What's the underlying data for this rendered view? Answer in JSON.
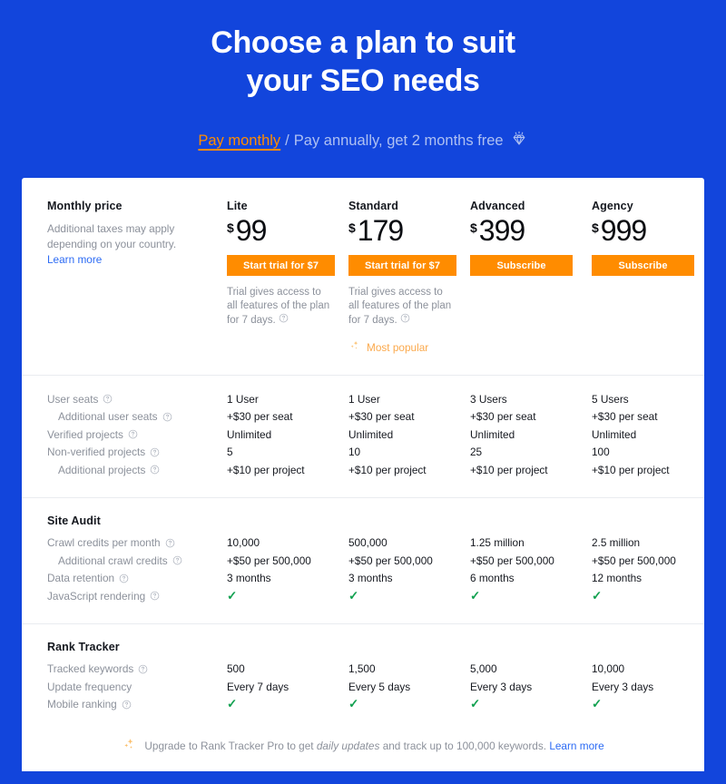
{
  "hero": {
    "title_line1": "Choose a plan to suit",
    "title_line2": "your SEO needs",
    "billing_active": "Pay monthly",
    "billing_separator": "/",
    "billing_alternative": "Pay annually, get 2 months free",
    "gem_icon": "gem-icon"
  },
  "colors": {
    "background_blue": "#1245DC",
    "accent_orange": "#FF8C00",
    "link_blue": "#2C6BF4",
    "check_green": "#12A150",
    "muted_text": "#8C919B"
  },
  "price_section": {
    "title": "Monthly price",
    "description": "Additional taxes may apply depending on your country.",
    "learn_more": "Learn more"
  },
  "plans": [
    {
      "name": "Lite",
      "currency": "$",
      "amount": "99",
      "cta": "Start trial for $7",
      "trial_note": "Trial gives access to all features of the plan for 7 days.",
      "has_trial_note": true,
      "most_popular": "",
      "is_popular": false
    },
    {
      "name": "Standard",
      "currency": "$",
      "amount": "179",
      "cta": "Start trial for $7",
      "trial_note": "Trial gives access to all features of the plan for 7 days.",
      "has_trial_note": true,
      "most_popular": "Most popular",
      "is_popular": true
    },
    {
      "name": "Advanced",
      "currency": "$",
      "amount": "399",
      "cta": "Subscribe",
      "trial_note": "",
      "has_trial_note": false,
      "most_popular": "",
      "is_popular": false
    },
    {
      "name": "Agency",
      "currency": "$",
      "amount": "999",
      "cta": "Subscribe",
      "trial_note": "",
      "has_trial_note": false,
      "most_popular": "",
      "is_popular": false
    }
  ],
  "sections": [
    {
      "group_title": "",
      "rows": [
        {
          "label": "User seats",
          "help": true,
          "indent": false,
          "values": [
            "1 User",
            "1 User",
            "3 Users",
            "5 Users"
          ],
          "type": "text"
        },
        {
          "label": "Additional user seats",
          "help": true,
          "indent": true,
          "values": [
            "+$30 per seat",
            "+$30 per seat",
            "+$30 per seat",
            "+$30 per seat"
          ],
          "type": "text"
        },
        {
          "label": "Verified projects",
          "help": true,
          "indent": false,
          "values": [
            "Unlimited",
            "Unlimited",
            "Unlimited",
            "Unlimited"
          ],
          "type": "text"
        },
        {
          "label": "Non-verified projects",
          "help": true,
          "indent": false,
          "values": [
            "5",
            "10",
            "25",
            "100"
          ],
          "type": "text"
        },
        {
          "label": "Additional projects",
          "help": true,
          "indent": true,
          "values": [
            "+$10 per project",
            "+$10 per project",
            "+$10 per project",
            "+$10 per project"
          ],
          "type": "text"
        }
      ]
    },
    {
      "group_title": "Site Audit",
      "rows": [
        {
          "label": "Crawl credits per month",
          "help": true,
          "indent": false,
          "values": [
            "10,000",
            "500,000",
            "1.25 million",
            "2.5 million"
          ],
          "type": "text"
        },
        {
          "label": "Additional crawl credits",
          "help": true,
          "indent": true,
          "values": [
            "+$50 per 500,000",
            "+$50 per 500,000",
            "+$50 per 500,000",
            "+$50 per 500,000"
          ],
          "type": "text"
        },
        {
          "label": "Data retention",
          "help": true,
          "indent": false,
          "values": [
            "3 months",
            "3 months",
            "6 months",
            "12 months"
          ],
          "type": "text"
        },
        {
          "label": "JavaScript rendering",
          "help": true,
          "indent": false,
          "values": [
            "✓",
            "✓",
            "✓",
            "✓"
          ],
          "type": "check"
        }
      ]
    },
    {
      "group_title": "Rank Tracker",
      "rows": [
        {
          "label": "Tracked keywords",
          "help": true,
          "indent": false,
          "values": [
            "500",
            "1,500",
            "5,000",
            "10,000"
          ],
          "type": "text"
        },
        {
          "label": "Update frequency",
          "help": false,
          "indent": false,
          "values": [
            "Every 7 days",
            "Every 5 days",
            "Every 3 days",
            "Every 3 days"
          ],
          "type": "text"
        },
        {
          "label": "Mobile ranking",
          "help": true,
          "indent": false,
          "values": [
            "✓",
            "✓",
            "✓",
            "✓"
          ],
          "type": "check"
        }
      ]
    }
  ],
  "footnote": {
    "sparkle_icon": "sparkle-icon",
    "text_before": "Upgrade to Rank Tracker Pro to get",
    "emphasis": "daily updates",
    "text_after": "and track up to 100,000 keywords.",
    "learn_more": "Learn more"
  }
}
